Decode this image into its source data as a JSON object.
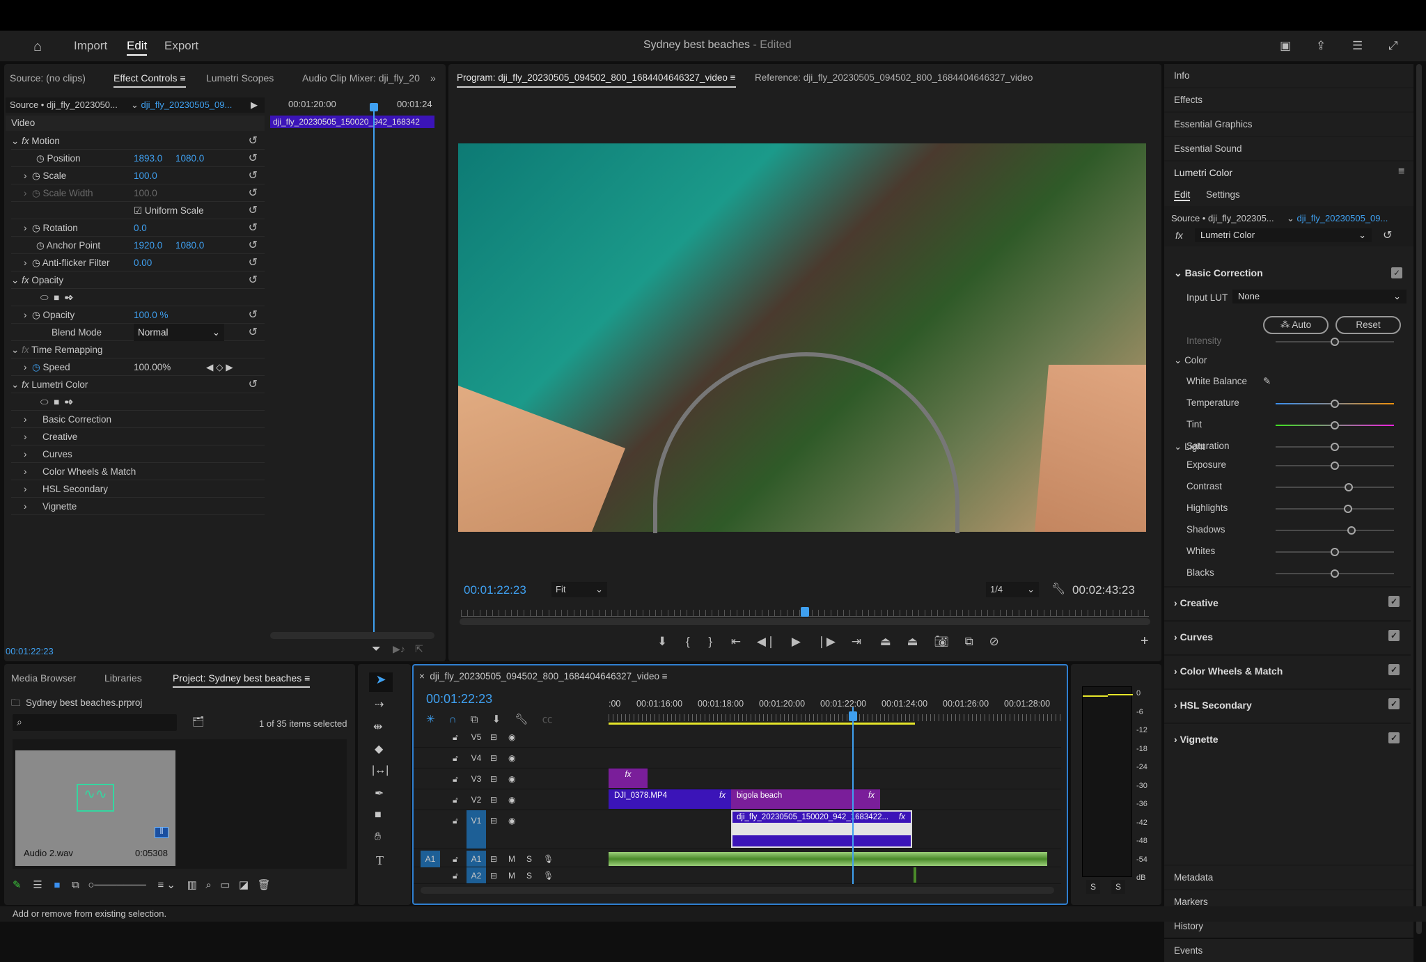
{
  "app": {
    "nav": [
      "Import",
      "Edit",
      "Export"
    ],
    "active_nav": "Edit",
    "project_title": "Sydney best beaches",
    "project_status": " - Edited"
  },
  "effect_controls": {
    "tabs": [
      "Source: (no clips)",
      "Effect Controls",
      "Lumetri Scopes",
      "Audio Clip Mixer: dji_fly_20"
    ],
    "source_label": "Source • dji_fly_2023050...",
    "clip_label": "dji_fly_20230505_09...",
    "ruler": [
      "00:01:20:00",
      "00:01:24"
    ],
    "mini_clip": "dji_fly_20230505_150020_942_168342",
    "video_header": "Video",
    "motion": {
      "label": "Motion",
      "position": [
        "1893.0",
        "1080.0"
      ],
      "scale": "100.0",
      "scale_width": "100.0",
      "uniform_scale": "Uniform Scale",
      "rotation": "0.0",
      "anchor_point": [
        "1920.0",
        "1080.0"
      ],
      "anti_flicker": "0.00"
    },
    "labels": {
      "position": "Position",
      "scale": "Scale",
      "scale_width": "Scale Width",
      "rotation": "Rotation",
      "anchor_point": "Anchor Point",
      "anti_flicker": "Anti-flicker Filter",
      "opacity_group": "Opacity",
      "opacity": "Opacity",
      "blend_mode": "Blend Mode",
      "time_remap": "Time Remapping",
      "speed": "Speed",
      "lumetri": "Lumetri Color"
    },
    "opacity_value": "100.0 %",
    "blend_mode_value": "Normal",
    "speed_value": "100.00%",
    "lumetri_children": [
      "Basic Correction",
      "Creative",
      "Curves",
      "Color Wheels & Match",
      "HSL Secondary",
      "Vignette"
    ],
    "timecode": "00:01:22:23"
  },
  "program": {
    "tab": "Program: dji_fly_20230505_094502_800_1684404646327_video",
    "reference_tab": "Reference: dji_fly_20230505_094502_800_1684404646327_video",
    "timecode": "00:01:22:23",
    "fit": "Fit",
    "resolution": "1/4",
    "duration": "00:02:43:23",
    "playhead_fraction": 0.5
  },
  "lumetri": {
    "panels_top": [
      "Info",
      "Effects",
      "Essential Graphics",
      "Essential Sound"
    ],
    "title": "Lumetri Color",
    "tabs": [
      "Edit",
      "Settings"
    ],
    "source_label": "Source • dji_fly_202305...",
    "clip_label": "dji_fly_20230505_09...",
    "effect_select": "Lumetri Color",
    "basic_correction": "Basic Correction",
    "input_lut_label": "Input LUT",
    "input_lut_value": "None",
    "auto_label": "Auto",
    "reset_label": "Reset",
    "intensity": {
      "label": "Intensity",
      "value": "50.0",
      "fraction": 0.5
    },
    "color_header": "Color",
    "white_balance": "White Balance",
    "color_sliders": [
      {
        "label": "Temperature",
        "value": "0.0",
        "fraction": 0.5
      },
      {
        "label": "Tint",
        "value": "0.0",
        "fraction": 0.5
      },
      {
        "label": "Saturation",
        "value": "100.0",
        "fraction": 0.5
      }
    ],
    "light_header": "Light",
    "light_sliders": [
      {
        "label": "Exposure",
        "value": "0.0",
        "fraction": 0.5
      },
      {
        "label": "Contrast",
        "value": "24.7",
        "fraction": 0.62
      },
      {
        "label": "Highlights",
        "value": "21.9",
        "fraction": 0.61
      },
      {
        "label": "Shadows",
        "value": "27.4",
        "fraction": 0.64
      },
      {
        "label": "Whites",
        "value": "0.0",
        "fraction": 0.5
      },
      {
        "label": "Blacks",
        "value": "0.0",
        "fraction": 0.5
      }
    ],
    "sections": [
      "Creative",
      "Curves",
      "Color Wheels & Match",
      "HSL Secondary",
      "Vignette"
    ],
    "panels_bottom": [
      "Metadata",
      "Markers",
      "History",
      "Events"
    ]
  },
  "project": {
    "tabs": [
      "Media Browser",
      "Libraries",
      "Project: Sydney best beaches"
    ],
    "file": "Sydney best beaches.prproj",
    "search_placeholder": "",
    "selection": "1 of 35 items selected",
    "item_name": "Audio 2.wav",
    "item_duration": "0:05308"
  },
  "timeline": {
    "sequence": "dji_fly_20230505_094502_800_1684404646327_video",
    "timecode": "00:01:22:23",
    "ruler": [
      ":00",
      "00:01:16:00",
      "00:01:18:00",
      "00:01:20:00",
      "00:01:22:00",
      "00:01:24:00",
      "00:01:26:00",
      "00:01:28:00"
    ],
    "video_tracks": [
      "V5",
      "V4",
      "V3",
      "V2",
      "V1"
    ],
    "audio_tracks": [
      "A1",
      "A2"
    ],
    "source_patch": "A1",
    "mute": "M",
    "solo": "S",
    "clips": {
      "v2a": "DJI_0378.MP4",
      "v2b": "bigola beach",
      "v1": "dji_fly_20230505_150020_942_1683422...",
      "fx": "fx"
    }
  },
  "meter": {
    "scale": [
      "0",
      "-6",
      "-12",
      "-18",
      "-24",
      "-30",
      "-36",
      "-42",
      "-48",
      "-54",
      "dB"
    ],
    "solo": [
      "S",
      "S"
    ]
  },
  "status_bar": "Add or remove from existing selection."
}
